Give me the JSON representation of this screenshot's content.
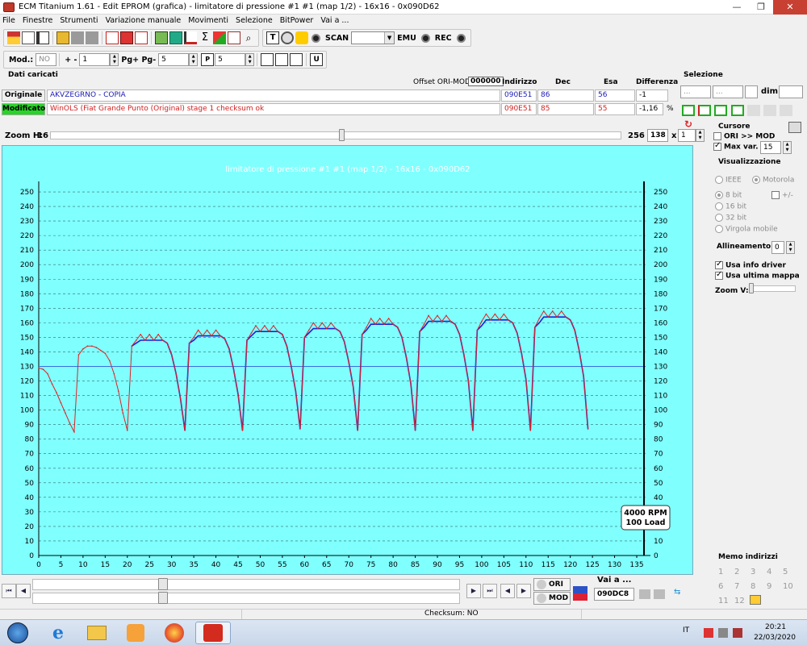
{
  "window": {
    "title": "ECM Titanium 1.61 - Edit EPROM (grafica) - limitatore di pressione #1 #1 (map 1/2) - 16x16 - 0x090D62",
    "minimize": "—",
    "restore": "❐",
    "close": "✕"
  },
  "menu": [
    "File",
    "Finestre",
    "Strumenti",
    "Variazione manuale",
    "Movimenti",
    "Selezione",
    "BitPower",
    "Vai a ..."
  ],
  "toolbar": {
    "scan_label": "SCAN",
    "emu_label": "EMU",
    "rec_label": "REC",
    "scan_value": ""
  },
  "toolbar2": {
    "mod_label": "Mod.:",
    "mod_value": "NO",
    "plusminus_label": "+ -",
    "plusminus_value": "1",
    "pg_label": "Pg+ Pg-",
    "pg_value": "5",
    "step_value": "5"
  },
  "data_panel": {
    "title": "Dati caricati",
    "offset_label": "Offset ORI-MOD",
    "offset_value": "000000",
    "col_indirizzo": "Indirizzo",
    "col_dec": "Dec",
    "col_esa": "Esa",
    "col_diff": "Differenza",
    "original": {
      "label": "Originale",
      "name": "AKVZEGRNO - COPIA",
      "address": "090E51",
      "dec": "86",
      "hex": "56",
      "diff": "-1",
      "diff_unit": ""
    },
    "modified": {
      "label": "Modificato",
      "name": "WinOLS (Fiat Grande Punto (Original) stage 1 checksum ok",
      "address": "090E51",
      "dec": "85",
      "hex": "55",
      "diff": "-1,16",
      "diff_unit": "%"
    }
  },
  "selection": {
    "title": "Selezione",
    "f1": "...",
    "f2": "...",
    "dim_label": "dim.",
    "dim_value": ""
  },
  "zoom": {
    "label": "Zoom H:",
    "value": "16",
    "max": "256",
    "cols": "138",
    "x_label": "x",
    "rows": "1"
  },
  "right_panel": {
    "cursor_title": "Cursore",
    "ori_mod_label": "ORI >> MOD",
    "maxvar_label": "Max var.",
    "maxvar_value": "15",
    "vis_title": "Visualizzazione",
    "ieee": "IEEE",
    "motorola": "Motorola",
    "bit8": "8 bit",
    "plusminus": "+/-",
    "bit16": "16 bit",
    "bit32": "32 bit",
    "float": "Virgola mobile",
    "align_label": "Allineamento:",
    "align_value": "0",
    "usa_info": "Usa info driver",
    "usa_ultima": "Usa ultima mappa",
    "zoomv": "Zoom V:",
    "memo_title": "Memo indirizzi",
    "memo": [
      "1",
      "2",
      "3",
      "4",
      "5",
      "6",
      "7",
      "8",
      "9",
      "10",
      "11",
      "12"
    ]
  },
  "bottom": {
    "ori_label": "ORI",
    "mod_label": "MOD",
    "vai_label": "Vai a ...",
    "vai_value": "090DC8"
  },
  "status": {
    "checksum": "Checksum: NO"
  },
  "taskbar": {
    "lang": "IT",
    "time": "20:21",
    "date": "22/03/2020"
  },
  "chart_data": {
    "type": "line",
    "title": "limitatore di pressione #1 #1 (map 1/2) - 16x16 - 0x090D62",
    "ylim": [
      0,
      255
    ],
    "yticks": [
      0,
      10,
      20,
      30,
      40,
      50,
      60,
      70,
      80,
      90,
      100,
      110,
      120,
      130,
      140,
      150,
      160,
      170,
      180,
      190,
      200,
      210,
      220,
      230,
      240,
      250
    ],
    "xlim": [
      0,
      137
    ],
    "xticks": [
      0,
      5,
      10,
      15,
      20,
      25,
      30,
      35,
      40,
      45,
      50,
      55,
      60,
      65,
      70,
      75,
      80,
      85,
      90,
      95,
      100,
      105,
      110,
      115,
      120,
      125,
      130,
      135
    ],
    "reference_line": 130,
    "cursor_x": 137,
    "cursor_label": [
      "4000 RPM",
      "100 Load"
    ],
    "colors": {
      "original": "#1f1fd6",
      "modified": "#e02020",
      "reference": "#3b6fe0",
      "background": "#80ffff"
    },
    "series_modified": [
      129,
      128,
      125,
      118,
      112,
      105,
      98,
      91,
      85,
      138,
      142,
      144,
      144,
      143,
      141,
      139,
      134,
      125,
      113,
      98,
      86,
      144,
      148,
      152,
      148,
      152,
      148,
      152,
      148,
      146,
      138,
      125,
      108,
      86,
      146,
      150,
      155,
      151,
      155,
      151,
      155,
      151,
      149,
      142,
      128,
      111,
      86,
      148,
      153,
      158,
      154,
      158,
      154,
      158,
      154,
      152,
      144,
      130,
      113,
      87,
      150,
      155,
      160,
      156,
      160,
      156,
      160,
      156,
      154,
      147,
      133,
      116,
      86,
      152,
      157,
      163,
      159,
      163,
      159,
      163,
      159,
      157,
      150,
      136,
      118,
      86,
      154,
      159,
      165,
      161,
      165,
      161,
      165,
      161,
      159,
      152,
      138,
      120,
      86,
      155,
      161,
      166,
      162,
      166,
      162,
      166,
      162,
      160,
      153,
      139,
      121,
      86,
      157,
      163,
      168,
      164,
      168,
      164,
      168,
      164,
      162,
      155,
      141,
      123,
      87
    ],
    "series_original": [
      null,
      null,
      null,
      null,
      null,
      null,
      null,
      null,
      null,
      null,
      null,
      null,
      null,
      null,
      null,
      null,
      null,
      null,
      null,
      null,
      null,
      144,
      146,
      148,
      148,
      148,
      148,
      148,
      148,
      146,
      138,
      125,
      108,
      86,
      146,
      148,
      151,
      151,
      151,
      151,
      151,
      151,
      149,
      142,
      128,
      111,
      86,
      148,
      151,
      154,
      154,
      154,
      154,
      154,
      154,
      152,
      144,
      130,
      113,
      87,
      150,
      153,
      156,
      156,
      156,
      156,
      156,
      156,
      154,
      147,
      133,
      116,
      86,
      152,
      155,
      159,
      159,
      159,
      159,
      159,
      159,
      157,
      150,
      136,
      118,
      86,
      154,
      157,
      161,
      161,
      161,
      161,
      161,
      161,
      159,
      152,
      138,
      120,
      86,
      155,
      158,
      162,
      162,
      162,
      162,
      162,
      162,
      160,
      153,
      139,
      121,
      86,
      157,
      160,
      164,
      164,
      164,
      164,
      164,
      164,
      162,
      155,
      141,
      123,
      87
    ]
  }
}
